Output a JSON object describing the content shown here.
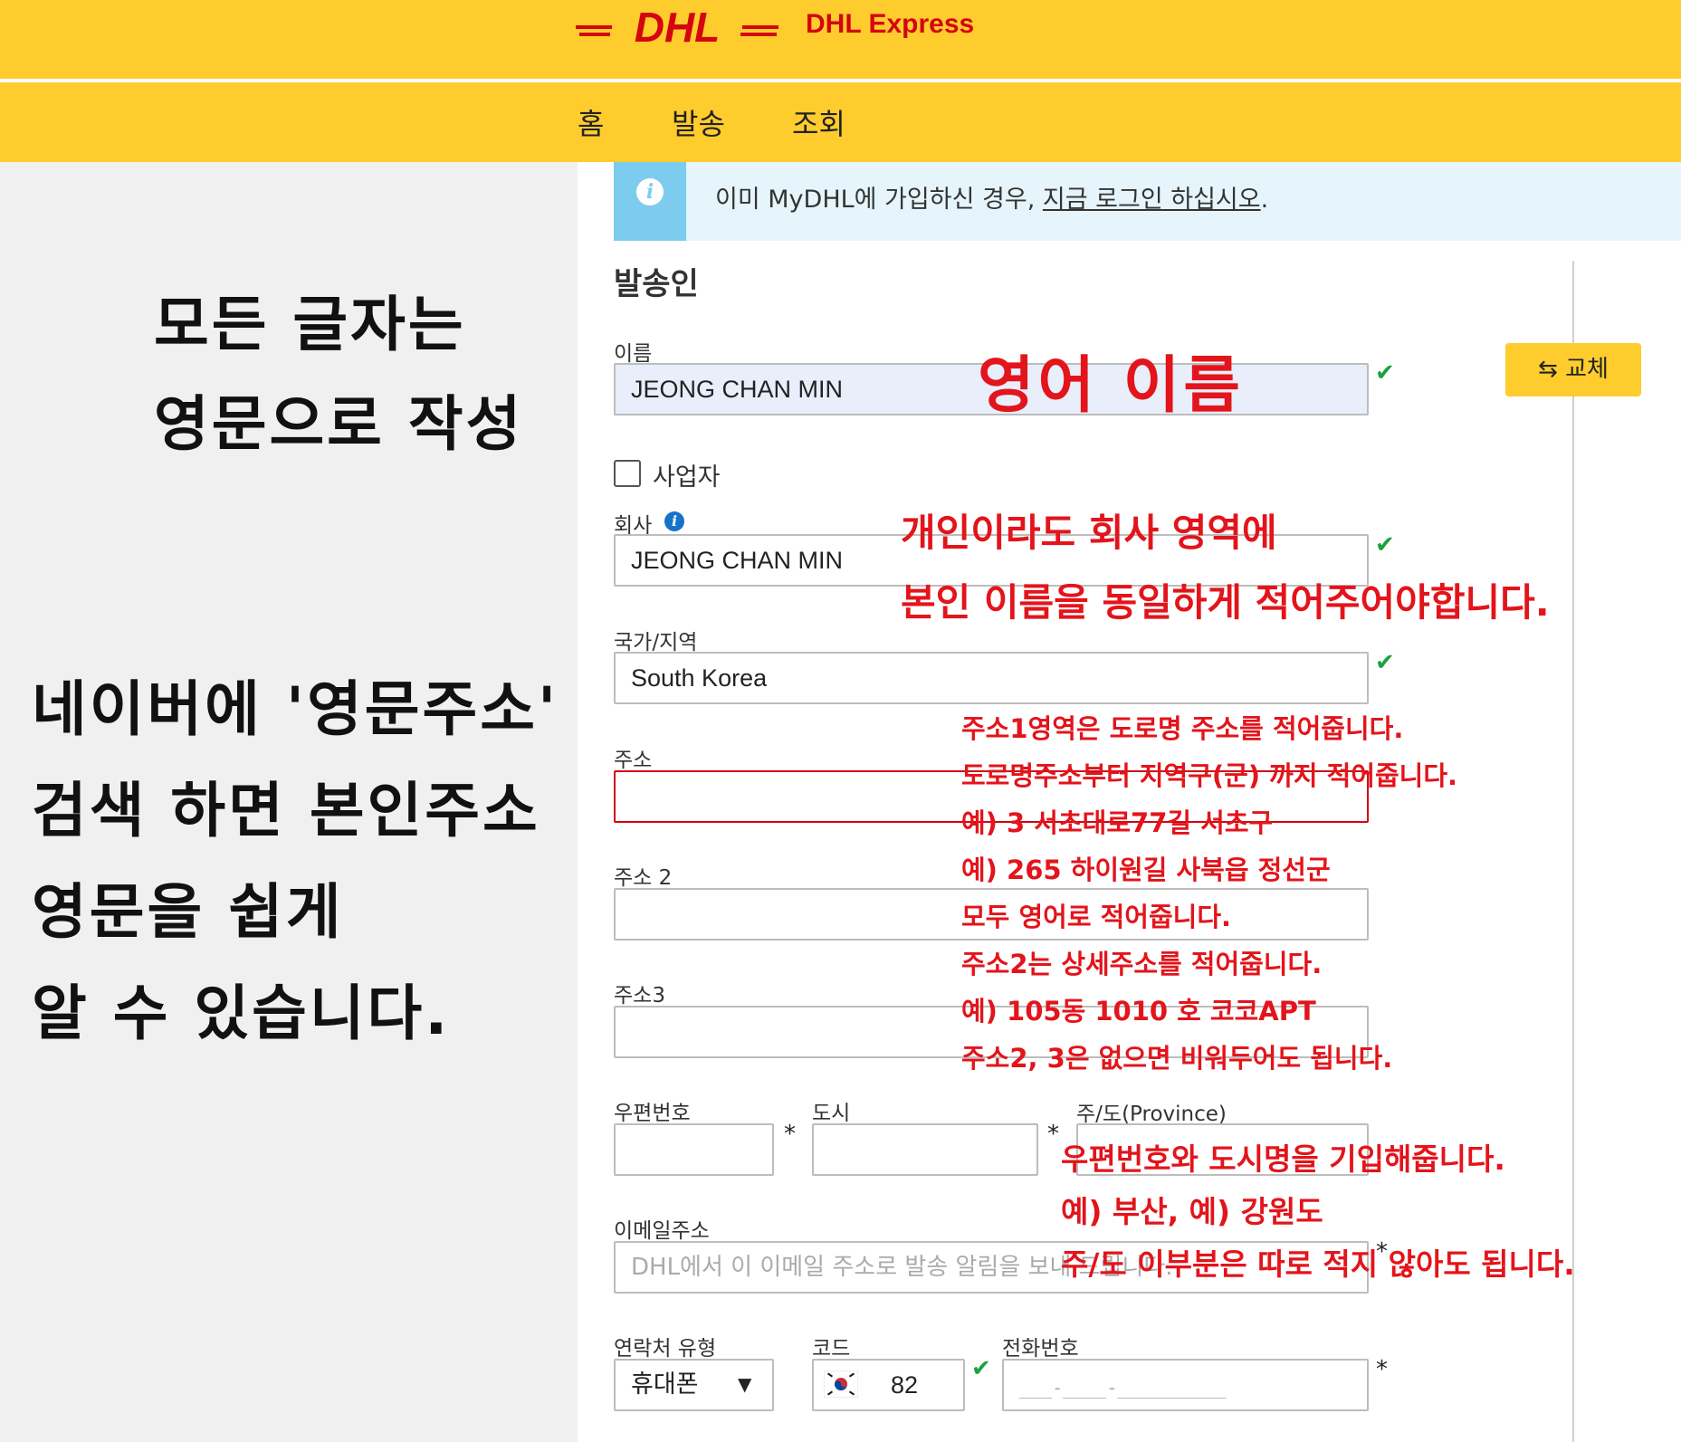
{
  "header": {
    "brand": "DHL Express",
    "logo_text": "DHL",
    "nav": [
      "홈",
      "발송",
      "조회"
    ]
  },
  "info": {
    "text": "이미 MyDHL에 가입하신 경우, ",
    "link": "지금 로그인 하십시오",
    "end": "."
  },
  "form": {
    "section_title": "발송인",
    "name_label": "이름",
    "name_value": "JEONG CHAN MIN",
    "swap_label": "교체",
    "business_label": "사업자",
    "company_label": "회사",
    "company_value": "JEONG CHAN MIN",
    "country_label": "국가/지역",
    "country_value": "South Korea",
    "address1_label": "주소",
    "address2_label": "주소 2",
    "address3_label": "주소3",
    "postcode_label": "우편번호",
    "city_label": "도시",
    "province_label": "주/도(Province)",
    "email_label": "이메일주소",
    "email_placeholder": "DHL에서 이 이메일 주소로 발송 알림을 보내 드립니다.",
    "contact_type_label": "연락처 유형",
    "contact_type_value": "휴대폰",
    "code_label": "코드",
    "code_value": "82",
    "phone_label": "전화번호",
    "phone_placeholder": "___-____-__________",
    "required_mark": "*"
  },
  "annotations": {
    "left_top": [
      "모든 글자는",
      "영문으로 작성"
    ],
    "left_bottom": [
      "네이버에 '영문주소'",
      "검색 하면 본인주소",
      "영문을 쉽게",
      "알 수 있습니다."
    ],
    "name_note": "영어 이름",
    "company_note": [
      "개인이라도 회사 영역에",
      "본인 이름을 동일하게 적어주어야합니다."
    ],
    "address_note": [
      "주소1영역은 도로명 주소를 적어줍니다.",
      "도로명주소부터 지역구(군) 까지 적어줍니다.",
      "예) 3 서초대로77길 서초구",
      "예) 265 하이원길 사북읍 정선군",
      "모두 영어로 적어줍니다.",
      "주소2는 상세주소를 적어줍니다.",
      "예) 105동 1010 호 코코APT",
      "주소2, 3은 없으면 비워두어도 됩니다."
    ],
    "postcode_note": [
      "우편번호와 도시명을 기입해줍니다.",
      "예) 부산, 예) 강원도",
      "주/도 이부분은 따로 적지 않아도 됩니다."
    ]
  },
  "colors": {
    "dhl_yellow": "#fecc2d",
    "dhl_red": "#d40511",
    "annotation_red": "#e3141b",
    "valid_green": "#1aa33c"
  }
}
